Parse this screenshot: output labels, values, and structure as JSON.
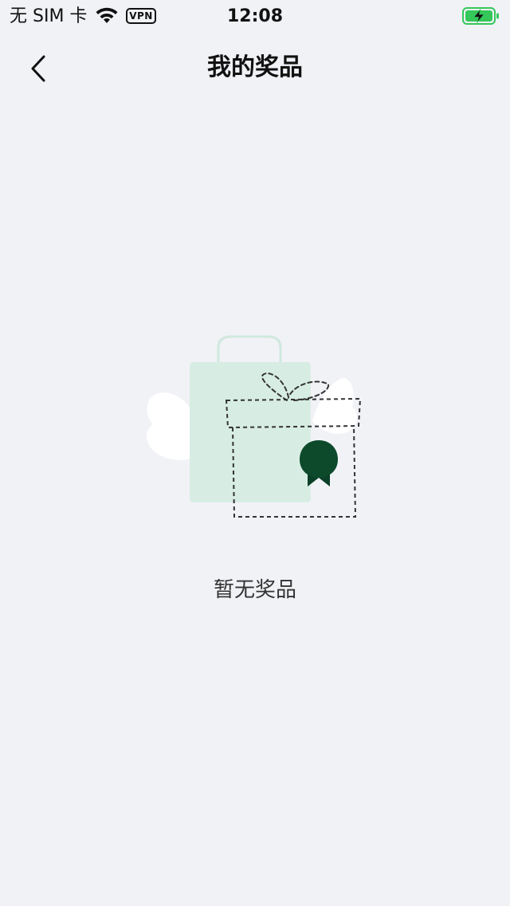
{
  "status_bar": {
    "carrier": "无 SIM 卡",
    "vpn": "VPN",
    "time": "12:08",
    "wifi_icon": "wifi-icon",
    "battery_icon": "battery-charging-icon",
    "battery_color": "#34c759"
  },
  "nav": {
    "back_icon": "chevron-left-icon",
    "title": "我的奖品"
  },
  "empty_state": {
    "illustration": "gift-bag-illustration",
    "message": "暂无奖品",
    "accent_color": "#0d4a2c"
  }
}
